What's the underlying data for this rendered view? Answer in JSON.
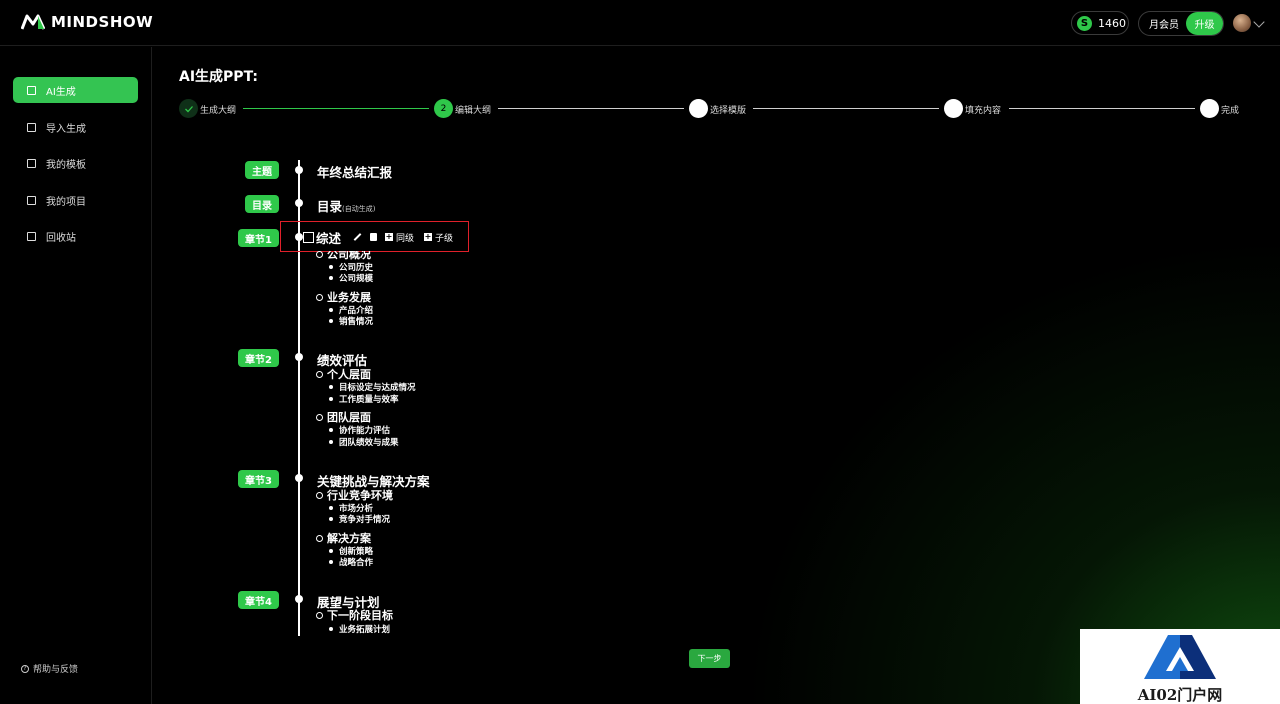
{
  "brand": {
    "name": "MINDSHOW"
  },
  "header": {
    "coins": "1460",
    "coin_symbol": "S",
    "member_label": "月会员",
    "upgrade_label": "升级"
  },
  "sidebar": {
    "items": [
      {
        "label": "AI生成",
        "icon": "ai-doc-icon"
      },
      {
        "label": "导入生成",
        "icon": "import-icon"
      },
      {
        "label": "我的模板",
        "icon": "template-icon"
      },
      {
        "label": "我的项目",
        "icon": "list-icon"
      },
      {
        "label": "回收站",
        "icon": "trash-icon"
      }
    ],
    "help_label": "帮助与反馈"
  },
  "page": {
    "title": "AI生成PPT:"
  },
  "steps": [
    {
      "label": "生成大纲",
      "state": "done"
    },
    {
      "label": "编辑大纲",
      "state": "current",
      "number": "2"
    },
    {
      "label": "选择模版",
      "state": "todo"
    },
    {
      "label": "填充内容",
      "state": "todo"
    },
    {
      "label": "完成",
      "state": "todo"
    }
  ],
  "outline": {
    "topic_tag": "主题",
    "topic": "年终总结汇报",
    "toc_tag": "目录",
    "toc": "目录",
    "toc_note": "(自动生成)",
    "toolbar": {
      "same_level": "同级",
      "child_level": "子级"
    },
    "chapters": [
      {
        "tag": "章节1",
        "title": "综述",
        "sections": [
          {
            "title": "公司概况",
            "items": [
              "公司历史",
              "公司规模"
            ]
          },
          {
            "title": "业务发展",
            "items": [
              "产品介绍",
              "销售情况"
            ]
          }
        ]
      },
      {
        "tag": "章节2",
        "title": "绩效评估",
        "sections": [
          {
            "title": "个人层面",
            "items": [
              "目标设定与达成情况",
              "工作质量与效率"
            ]
          },
          {
            "title": "团队层面",
            "items": [
              "协作能力评估",
              "团队绩效与成果"
            ]
          }
        ]
      },
      {
        "tag": "章节3",
        "title": "关键挑战与解决方案",
        "sections": [
          {
            "title": "行业竞争环境",
            "items": [
              "市场分析",
              "竞争对手情况"
            ]
          },
          {
            "title": "解决方案",
            "items": [
              "创新策略",
              "战略合作"
            ]
          }
        ]
      },
      {
        "tag": "章节4",
        "title": "展望与计划",
        "sections": [
          {
            "title": "下一阶段目标",
            "items": [
              "业务拓展计划"
            ]
          }
        ]
      }
    ]
  },
  "next_label": "下一步",
  "watermark": {
    "text": "AI02门户网"
  },
  "colors": {
    "accent": "#2fc84a",
    "highlight": "#e0202a",
    "background": "#000000"
  }
}
